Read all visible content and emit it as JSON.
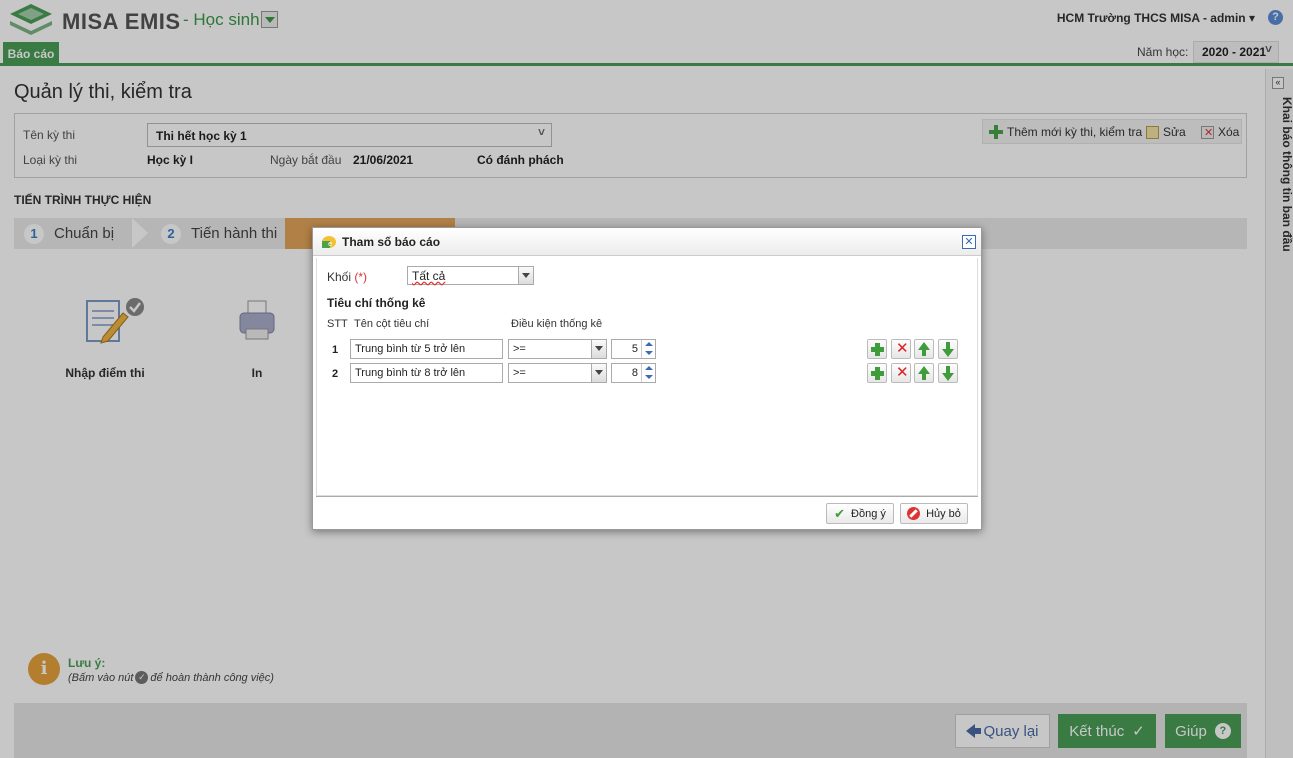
{
  "app": {
    "logo_text": "MISA EMIS",
    "module": "- Học sinh",
    "user": "HCM Trường THCS MISA - admin ▾",
    "help_glyph": "?"
  },
  "tabs": {
    "active": "Báo cáo"
  },
  "school_year": {
    "label": "Năm học:",
    "value": "2020 - 2021"
  },
  "page": {
    "title": "Quản lý thi, kiểm tra",
    "exam_name_label": "Tên kỳ thi",
    "exam_name_value": "Thi hết học kỳ 1",
    "exam_type_label": "Loại kỳ thi",
    "exam_type_value": "Học kỳ I",
    "start_date_label": "Ngày bắt đầu",
    "start_date_value": "21/06/2021",
    "anonymize_value": "Có đánh phách"
  },
  "toolbar": {
    "add": "Thêm mới kỳ thi, kiểm tra",
    "edit": "Sửa",
    "delete": "Xóa"
  },
  "progress": {
    "title": "TIẾN TRÌNH THỰC HIỆN",
    "steps": [
      {
        "num": "1",
        "label": "Chuẩn bị"
      },
      {
        "num": "2",
        "label": "Tiến hành thi"
      }
    ]
  },
  "tasks": [
    {
      "label": "Nhập điểm thi",
      "icon": "notepad-pencil-icon"
    },
    {
      "label": "In",
      "icon": "printer-icon"
    }
  ],
  "note": {
    "title": "Lưu ý:",
    "text_before": "(Bấm vào nút",
    "text_after": "để hoàn thành công việc)"
  },
  "footer": {
    "back": "Quay lại",
    "finish": "Kết thúc",
    "help": "Giúp"
  },
  "sidebar": {
    "text": "Khai báo thông tin ban đầu"
  },
  "dialog": {
    "title": "Tham số báo cáo",
    "grade_label": "Khối",
    "required_mark": "(*)",
    "grade_value": "Tất cả",
    "section_title": "Tiêu chí thống kê",
    "col_stt": "STT",
    "col_name": "Tên cột tiêu chí",
    "col_condition": "Điều kiện thống kê",
    "rows": [
      {
        "stt": "1",
        "name": "Trung bình từ 5 trở lên",
        "op": ">=",
        "value": "5"
      },
      {
        "stt": "2",
        "name": "Trung bình từ 8 trở lên",
        "op": ">=",
        "value": "8"
      }
    ],
    "ok": "Đồng ý",
    "cancel": "Hủy bỏ"
  },
  "colors": {
    "brand_green": "#4b9e57",
    "step_active": "#e3a45a",
    "accent_blue": "#3b6bb3"
  }
}
